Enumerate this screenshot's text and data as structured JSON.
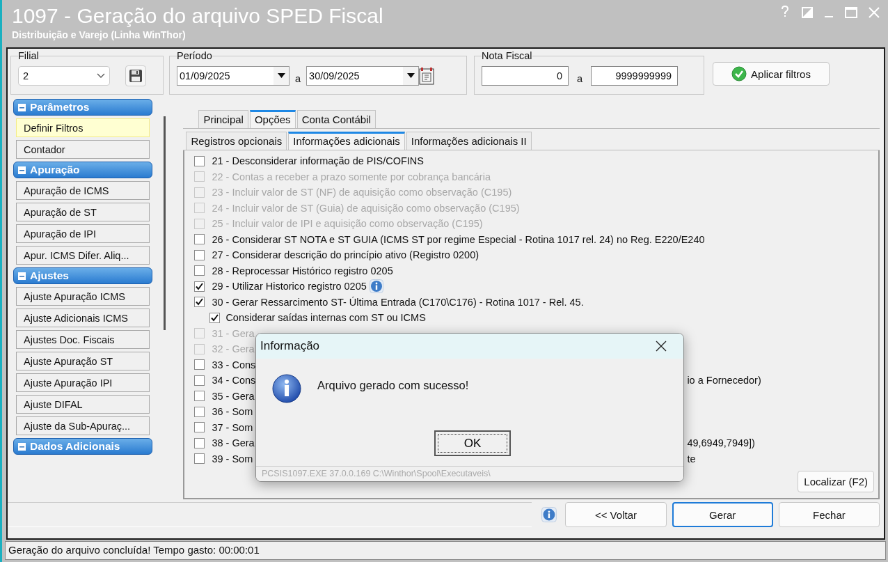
{
  "window": {
    "title": "1097 - Geração do arquivo SPED Fiscal",
    "subtitle": "Distribuição e Varejo (Linha WinThor)"
  },
  "filters": {
    "filial": {
      "label": "Filial",
      "value": "2"
    },
    "periodo": {
      "label": "Período",
      "from": "01/09/2025",
      "separator": "a",
      "to": "30/09/2025"
    },
    "nota_fiscal": {
      "label": "Nota Fiscal",
      "from": "0",
      "separator": "a",
      "to": "9999999999"
    },
    "apply_button": "Aplicar filtros"
  },
  "sidebar": {
    "groups": [
      {
        "title": "Parâmetros",
        "expanded": true,
        "items": [
          {
            "label": "Definir Filtros",
            "selected": true
          },
          {
            "label": "Contador",
            "selected": false
          }
        ]
      },
      {
        "title": "Apuração",
        "expanded": true,
        "items": [
          {
            "label": "Apuração de ICMS",
            "selected": false
          },
          {
            "label": "Apuração de ST",
            "selected": false
          },
          {
            "label": "Apuração de IPI",
            "selected": false
          },
          {
            "label": "Apur. ICMS Difer. Aliq...",
            "selected": false
          }
        ]
      },
      {
        "title": "Ajustes",
        "expanded": true,
        "items": [
          {
            "label": "Ajuste Apuração ICMS",
            "selected": false
          },
          {
            "label": "Ajuste Adicionais ICMS",
            "selected": false
          },
          {
            "label": "Ajustes Doc. Fiscais",
            "selected": false
          },
          {
            "label": "Ajuste Apuração ST",
            "selected": false
          },
          {
            "label": "Ajuste Apuração IPI",
            "selected": false
          },
          {
            "label": "Ajuste DIFAL",
            "selected": false
          },
          {
            "label": "Ajuste da Sub-Apuraç...",
            "selected": false
          }
        ]
      },
      {
        "title": "Dados Adicionais",
        "expanded": true
      }
    ]
  },
  "tabs": [
    {
      "label": "Principal",
      "selected": false
    },
    {
      "label": "Opções",
      "selected": true
    },
    {
      "label": "Conta Contábil",
      "selected": false
    }
  ],
  "subtabs": [
    {
      "label": "Registros opcionais",
      "selected": false
    },
    {
      "label": "Informações adicionais",
      "selected": true
    },
    {
      "label": "Informações adicionais II",
      "selected": false
    }
  ],
  "options": [
    {
      "text": "21 - Desconsiderar informação de PIS/COFINS",
      "checked": false,
      "disabled": false
    },
    {
      "text": "22 - Contas a receber a prazo somente por cobrança bancária",
      "checked": false,
      "disabled": true
    },
    {
      "text": "23 - Incluir valor de ST (NF) de aquisição como observação (C195)",
      "checked": false,
      "disabled": true
    },
    {
      "text": "24 - Incluir valor de ST (Guia) de aquisição como observação (C195)",
      "checked": false,
      "disabled": true
    },
    {
      "text": "25 - Incluir valor de IPI e aquisição como observação (C195)",
      "checked": false,
      "disabled": true
    },
    {
      "text": "26 - Considerar ST NOTA e ST GUIA (ICMS ST por regime Especial - Rotina 1017 rel. 24) no Reg. E220/E240",
      "checked": false,
      "disabled": false
    },
    {
      "text": "27 - Considerar descrição do princípio ativo (Registro 0200)",
      "checked": false,
      "disabled": false
    },
    {
      "text": "28 - Reprocessar Histórico registro 0205",
      "checked": false,
      "disabled": false
    },
    {
      "text": "29 - Utilizar Historico registro 0205",
      "checked": true,
      "disabled": false,
      "info": true
    },
    {
      "text": "30 - Gerar Ressarcimento ST- Última Entrada (C170\\C176) - Rotina 1017 - Rel. 45.",
      "checked": true,
      "disabled": false,
      "children": [
        {
          "text": "Considerar saídas internas com ST ou ICMS",
          "checked": true,
          "disabled": false
        }
      ]
    },
    {
      "text": "31 - Gera",
      "checked": false,
      "disabled": true
    },
    {
      "text": "32 - Gera",
      "checked": false,
      "disabled": true
    },
    {
      "text": "33 - Cons",
      "checked": false,
      "disabled": false
    },
    {
      "text": "34 - Cons",
      "text_right": "io a Fornecedor)",
      "checked": false,
      "disabled": false
    },
    {
      "text": "35 - Gera",
      "checked": false,
      "disabled": false
    },
    {
      "text": "36 - Som",
      "checked": false,
      "disabled": false
    },
    {
      "text": "37 - Som",
      "checked": false,
      "disabled": false
    },
    {
      "text": "38 - Gera",
      "text_right": "49,6949,7949])",
      "checked": false,
      "disabled": false
    },
    {
      "text": "39 - Som",
      "text_right": "te",
      "checked": false,
      "disabled": false
    }
  ],
  "find_button": "Localizar (F2)",
  "bottom_buttons": [
    {
      "label": "<< Voltar",
      "default": false
    },
    {
      "label": "Gerar",
      "default": true
    },
    {
      "label": "Fechar",
      "default": false
    }
  ],
  "status_bar": "Geração do arquivo concluída! Tempo gasto: 00:00:01",
  "dialog": {
    "title": "Informação",
    "message": "Arquivo gerado com sucesso!",
    "button": "OK",
    "footer": "PCSIS1097.EXE 37.0.0.169 C:\\Winthor\\Spool\\Executaveis\\"
  }
}
